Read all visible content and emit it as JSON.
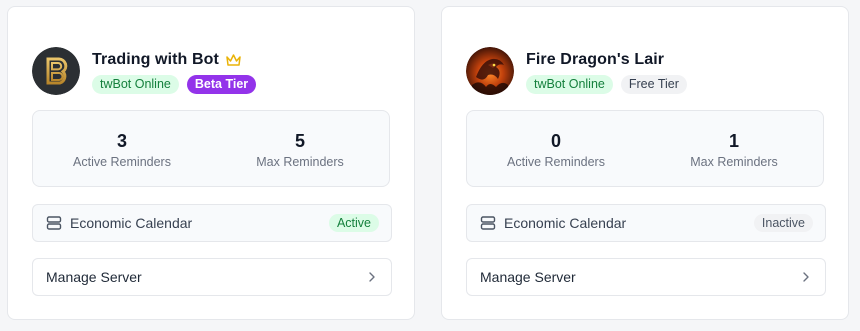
{
  "servers": [
    {
      "name": "Trading with Bot",
      "has_crown": true,
      "crown_color": "#eab308",
      "status_badge": "twBot Online",
      "tier_badge": "Beta Tier",
      "tier_style": "beta",
      "active_reminders_value": "3",
      "active_reminders_label": "Active Reminders",
      "max_reminders_value": "5",
      "max_reminders_label": "Max Reminders",
      "calendar_label": "Economic Calendar",
      "calendar_status": "Active",
      "manage_label": "Manage Server",
      "avatar_icon": "b-logo-icon"
    },
    {
      "name": "Fire Dragon's Lair",
      "has_crown": false,
      "status_badge": "twBot Online",
      "tier_badge": "Free Tier",
      "tier_style": "free",
      "active_reminders_value": "0",
      "active_reminders_label": "Active Reminders",
      "max_reminders_value": "1",
      "max_reminders_label": "Max Reminders",
      "calendar_label": "Economic Calendar",
      "calendar_status": "Inactive",
      "manage_label": "Manage Server",
      "avatar_icon": "dragon-image"
    }
  ],
  "colors": {
    "online_bg": "#dcfce7",
    "online_text": "#15803d",
    "beta_bg": "#9333ea",
    "free_bg": "#f1f2f4"
  }
}
